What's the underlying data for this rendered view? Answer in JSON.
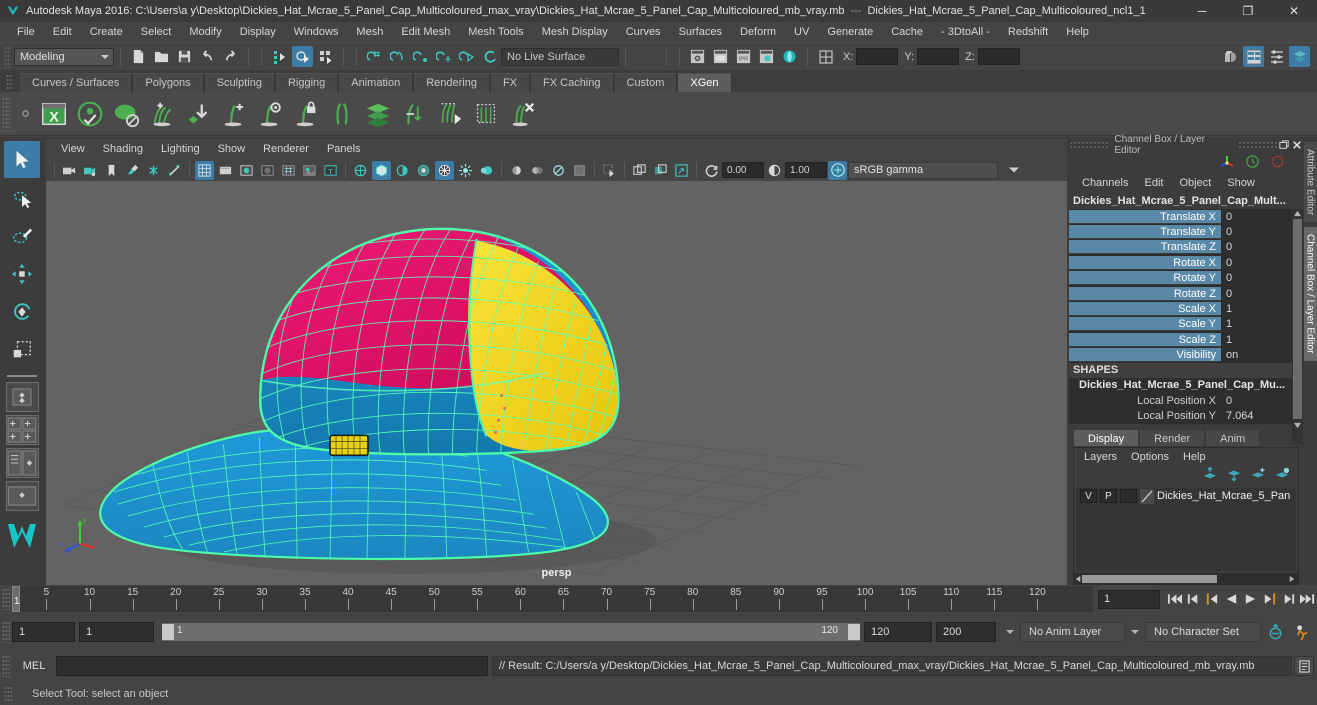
{
  "window": {
    "app_title": "Autodesk Maya 2016: C:\\Users\\a y\\Desktop\\Dickies_Hat_Mcrae_5_Panel_Cap_Multicoloured_max_vray\\Dickies_Hat_Mcrae_5_Panel_Cap_Multicoloured_mb_vray.mb",
    "title_separator": "---",
    "node_title": "Dickies_Hat_Mcrae_5_Panel_Cap_Multicoloured_ncl1_1",
    "minimize": "─",
    "maximize": "❐",
    "close": "✕"
  },
  "menubar": {
    "items": [
      "File",
      "Edit",
      "Create",
      "Select",
      "Modify",
      "Display",
      "Windows",
      "Mesh",
      "Edit Mesh",
      "Mesh Tools",
      "Mesh Display",
      "Curves",
      "Surfaces",
      "Deform",
      "UV",
      "Generate",
      "Cache",
      "- 3DtoAll -",
      "Redshift",
      "Help"
    ]
  },
  "status_toolbar": {
    "mode": "Modeling",
    "live_surface": "No Live Surface",
    "x_label": "X:",
    "y_label": "Y:",
    "z_label": "Z:",
    "x_value": "",
    "y_value": "",
    "z_value": "",
    "icons": [
      "new-scene-icon",
      "open-scene-icon",
      "save-scene-icon",
      "undo-icon",
      "redo-icon",
      "select-hierarchy-icon",
      "select-object-icon",
      "select-component-icon",
      "snap-grid-icon",
      "snap-curve-icon",
      "snap-point-icon",
      "snap-projected-icon",
      "snap-view-plane-icon",
      "make-live-icon",
      "render-current-frame-icon",
      "render-sequence-icon",
      "ipr-render-icon",
      "render-settings-icon",
      "hypershade-icon",
      "render-view-icon",
      "editor-layout-icon",
      "attribute-editor-toggle-icon",
      "tool-settings-toggle-icon",
      "channel-box-toggle-icon"
    ]
  },
  "shelf": {
    "tabs": [
      "Curves / Surfaces",
      "Polygons",
      "Sculpting",
      "Rigging",
      "Animation",
      "Rendering",
      "FX",
      "FX Caching",
      "Custom",
      "XGen"
    ],
    "active_tab": "XGen",
    "icons": [
      "xgen-window-icon",
      "xgen-preview-icon",
      "xgen-ptex-icon",
      "xgen-add-grooming-icon",
      "xgen-place-icon",
      "xgen-add-guide-icon",
      "xgen-edit-guide-icon",
      "xgen-lock-guide-icon",
      "xgen-split-guide-icon",
      "xgen-layers-icon",
      "xgen-length-icon",
      "xgen-select-guide-icon",
      "xgen-region-icon",
      "xgen-delete-guide-icon"
    ]
  },
  "toolbox": {
    "items": [
      "select-tool",
      "lasso-select-tool",
      "paint-select-tool",
      "move-tool",
      "rotate-tool",
      "scale-tool",
      "last-tool-used",
      "single-perspective-layout",
      "four-view-layout",
      "persp-outliner-layout",
      "persp-graph-layout",
      "hypershade-layout"
    ],
    "active": "select-tool"
  },
  "viewport": {
    "menus": [
      "View",
      "Shading",
      "Lighting",
      "Show",
      "Renderer",
      "Panels"
    ],
    "camera_label": "persp",
    "toolbar": {
      "exposure_value": "0.00",
      "gamma_value": "1.00",
      "color_profile": "sRGB gamma",
      "icons": [
        "select-camera-icon",
        "lock-camera-icon",
        "bookmark-icon",
        "image-plane-icon",
        "grid-toggle-icon",
        "measure-icon",
        "wireframe-icon",
        "smooth-shade-all-icon",
        "smooth-shade-selected-icon",
        "flat-shade-icon",
        "wireframe-on-shaded-icon",
        "texture-icon",
        "text-icon",
        "use-default-light-icon",
        "use-all-lights-icon",
        "shadows-icon",
        "ambient-occlusion-icon",
        "motion-blur-icon",
        "multisample-icon",
        "depth-of-field-icon",
        "isolate-select-icon",
        "xray-icon",
        "xray-joints-icon",
        "xray-active-components-icon",
        "exposure-icon",
        "gamma-icon",
        "color-management-icon"
      ]
    },
    "axis_gizmo": {
      "x": "x",
      "y": "y",
      "z": "z"
    }
  },
  "channel_box": {
    "panel_title": "Channel Box / Layer Editor",
    "menus": [
      "Channels",
      "Edit",
      "Object",
      "Show"
    ],
    "object_name": "Dickies_Hat_Mcrae_5_Panel_Cap_Mult...",
    "transform_attrs": [
      {
        "name": "Translate X",
        "value": "0"
      },
      {
        "name": "Translate Y",
        "value": "0"
      },
      {
        "name": "Translate Z",
        "value": "0"
      },
      {
        "name": "Rotate X",
        "value": "0"
      },
      {
        "name": "Rotate Y",
        "value": "0"
      },
      {
        "name": "Rotate Z",
        "value": "0"
      },
      {
        "name": "Scale X",
        "value": "1"
      },
      {
        "name": "Scale Y",
        "value": "1"
      },
      {
        "name": "Scale Z",
        "value": "1"
      },
      {
        "name": "Visibility",
        "value": "on"
      }
    ],
    "shapes_header": "SHAPES",
    "shape_name": "Dickies_Hat_Mcrae_5_Panel_Cap_Mu...",
    "shape_attrs": [
      {
        "name": "Local Position X",
        "value": "0"
      },
      {
        "name": "Local Position Y",
        "value": "7.064"
      }
    ]
  },
  "layer_editor": {
    "tabs": [
      "Display",
      "Render",
      "Anim"
    ],
    "active_tab": "Display",
    "menus": [
      "Layers",
      "Options",
      "Help"
    ],
    "toolbar_icons": [
      "layer-move-up-icon",
      "layer-move-down-icon",
      "layer-new-icon",
      "layer-new-from-selected-icon"
    ],
    "layers": [
      {
        "visibility": "V",
        "playback": "P",
        "shading": "",
        "name": "Dickies_Hat_Mcrae_5_Pan"
      }
    ]
  },
  "side_tabs": {
    "attribute_editor": "Attribute Editor",
    "channel_box": "Channel Box / Layer Editor"
  },
  "time_slider": {
    "ticks": [
      5,
      10,
      15,
      20,
      25,
      30,
      35,
      40,
      45,
      50,
      55,
      60,
      65,
      70,
      75,
      80,
      85,
      90,
      95,
      100,
      105,
      110,
      115,
      120
    ],
    "start": 1,
    "end": 120,
    "current_frame": "1",
    "current_frame_field": "1",
    "playback_buttons": [
      "go-to-start-icon",
      "step-back-frame-icon",
      "step-back-key-icon",
      "play-backwards-icon",
      "play-forwards-icon",
      "step-forward-key-icon",
      "step-forward-frame-icon",
      "go-to-end-icon"
    ]
  },
  "range_slider": {
    "anim_start": "1",
    "range_start": "1",
    "bar_start_label": "1",
    "bar_end_label": "120",
    "range_end": "120",
    "anim_end": "200",
    "anim_layer": "No Anim Layer",
    "character_set": "No Character Set",
    "auto_key_icon": "auto-keyframe-icon",
    "anim_prefs_icon": "animation-preferences-icon"
  },
  "command_line": {
    "language_label": "MEL",
    "input_value": "",
    "result_text": "// Result: C:/Users/a y/Desktop/Dickies_Hat_Mcrae_5_Panel_Cap_Multicoloured_max_vray/Dickies_Hat_Mcrae_5_Panel_Cap_Multicoloured_mb_vray.mb",
    "script_editor_icon": "script-editor-icon"
  },
  "help_line": {
    "text": "Select Tool: select an object"
  },
  "model": {
    "description": "3D wireframe-shaded baseball cap, 5-panel, multicoloured",
    "colors": {
      "panel_pink": "#e8126a",
      "panel_yellow": "#f2d617",
      "panel_blue": "#1a8fd0",
      "wireframe": "#3dfba0",
      "selection_highlight": "#4ad9a0",
      "grid": "#555555",
      "viewport_bg": "#636363"
    }
  },
  "theme": {
    "accent_blue": "#3e7ca8",
    "panel_bg": "#444444",
    "dark_bg": "#2e2e2e",
    "channel_attr_blue": "#5a89a8",
    "orange": "#e0801a"
  }
}
